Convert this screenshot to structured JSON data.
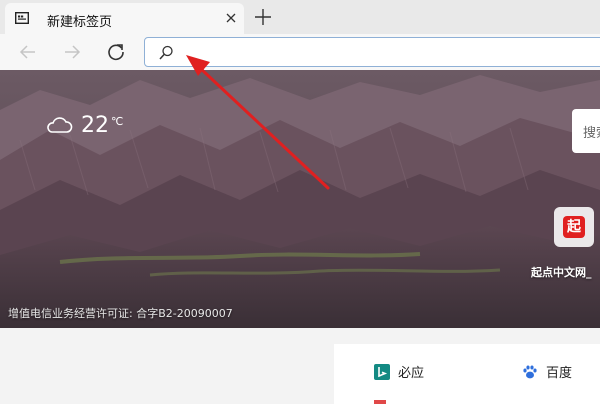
{
  "tab": {
    "title": "新建标签页",
    "favicon": "new-tab-page-icon",
    "close": "close-icon"
  },
  "toolbar": {
    "new_tab": "plus-icon",
    "back": "back-arrow-icon",
    "forward": "forward-arrow-icon",
    "refresh": "refresh-icon",
    "address_value": "",
    "search_icon": "search-icon"
  },
  "hero": {
    "weather_temp": "22",
    "weather_unit": "℃",
    "weather_icon": "cloud-icon",
    "search_text": "搜索",
    "quick_link": {
      "logo_text": "起",
      "label": "起点中文网_"
    },
    "license": "增值电信业务经营许可证: 合字B2-20090007"
  },
  "links": [
    {
      "label": "必应",
      "icon": "bing-icon"
    },
    {
      "label": "百度",
      "icon": "baidu-paw-icon"
    }
  ],
  "colors": {
    "annotation_arrow": "#e02020",
    "omnibox_border": "#8fb0d6",
    "bing": "#138a83",
    "baidu": "#2f6fdc"
  }
}
